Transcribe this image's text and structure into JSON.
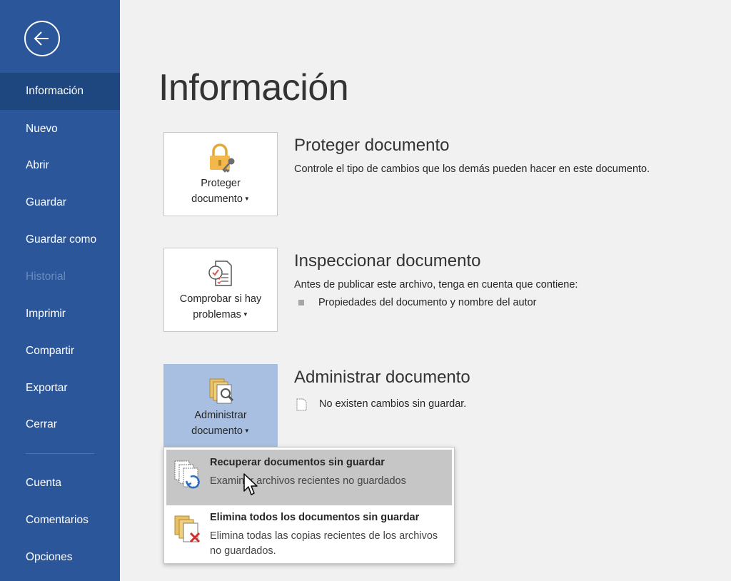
{
  "sidebar": {
    "items": [
      {
        "label": "Información",
        "state": "active"
      },
      {
        "label": "Nuevo",
        "state": "normal"
      },
      {
        "label": "Abrir",
        "state": "normal"
      },
      {
        "label": "Guardar",
        "state": "normal"
      },
      {
        "label": "Guardar como",
        "state": "normal"
      },
      {
        "label": "Historial",
        "state": "disabled"
      },
      {
        "label": "Imprimir",
        "state": "normal"
      },
      {
        "label": "Compartir",
        "state": "normal"
      },
      {
        "label": "Exportar",
        "state": "normal"
      },
      {
        "label": "Cerrar",
        "state": "normal"
      },
      {
        "label": "Cuenta",
        "state": "normal"
      },
      {
        "label": "Comentarios",
        "state": "normal"
      },
      {
        "label": "Opciones",
        "state": "normal"
      }
    ],
    "back_icon": "back-arrow-icon"
  },
  "main": {
    "title": "Información",
    "sections": [
      {
        "tile_line1": "Proteger",
        "tile_line2": "documento",
        "tile_icon": "lock-key-icon",
        "title": "Proteger documento",
        "description": "Controle el tipo de cambios que los demás pueden hacer en este documento."
      },
      {
        "tile_line1": "Comprobar si hay",
        "tile_line2": "problemas",
        "tile_icon": "inspect-checklist-icon",
        "title": "Inspeccionar documento",
        "description": "Antes de publicar este archivo, tenga en cuenta que contiene:",
        "bullet": "Propiedades del documento y nombre del autor"
      },
      {
        "tile_line1": "Administrar",
        "tile_line2": "documento",
        "tile_icon": "manage-documents-icon",
        "title": "Administrar documento",
        "status": "No existen cambios sin guardar."
      }
    ]
  },
  "dropdown": {
    "items": [
      {
        "title": "Recuperar documentos sin guardar",
        "description": "Examinar archivos recientes no guardados",
        "icon": "recover-documents-icon"
      },
      {
        "title": "Elimina todos los documentos sin guardar",
        "description": "Elimina todas las copias recientes de los archivos no guardados.",
        "icon": "delete-documents-icon"
      }
    ]
  },
  "colors": {
    "sidebar": "#2b579a",
    "sidebar_active": "#1f477f",
    "tile_pressed": "#a9bfe1",
    "menu_hover": "#c6c6c6"
  }
}
